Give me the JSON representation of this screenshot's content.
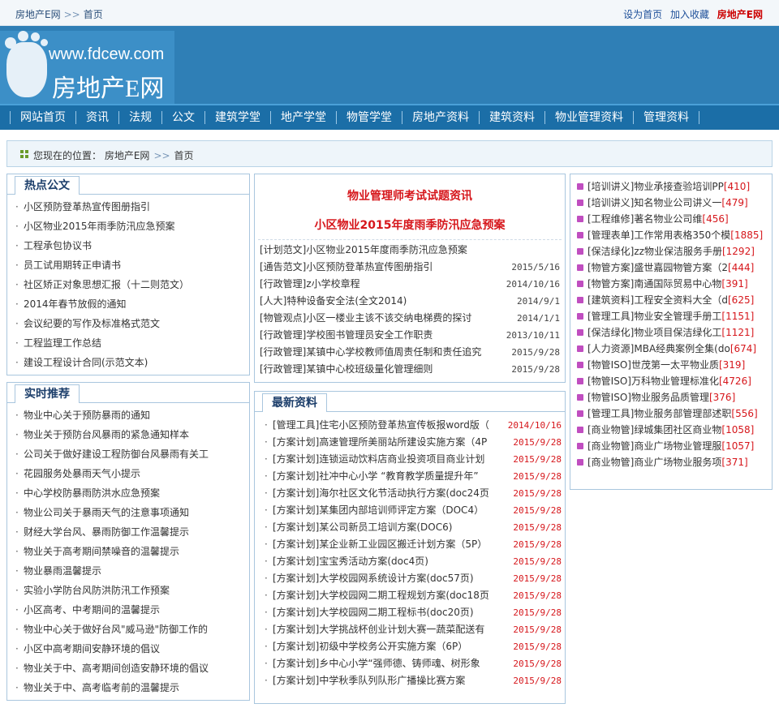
{
  "topbar": {
    "crumb_home": "房地产E网",
    "crumb_sep": ">>",
    "crumb_current": "首页",
    "set_home": "设为首页",
    "add_fav": "加入收藏",
    "brand": "房地产E网"
  },
  "logo": {
    "url": "www.fdcew.com",
    "cn": "房地产E网"
  },
  "nav": [
    "网站首页",
    "资讯",
    "法规",
    "公文",
    "建筑学堂",
    "地产学堂",
    "物管学堂",
    "房地产资料",
    "建筑资料",
    "物业管理资料",
    "管理资料"
  ],
  "location": {
    "label": "您现在的位置：",
    "home": "房地产E网",
    "sep": ">>",
    "current": "首页"
  },
  "hot": {
    "title": "热点公文",
    "items": [
      "小区预防登革热宣传图册指引",
      "小区物业2015年雨季防汛应急预案",
      "工程承包协议书",
      "员工试用期转正申请书",
      "社区矫正对象思想汇报（十二则范文）",
      "2014年春节放假的通知",
      "会议纪要的写作及标准格式范文",
      "工程监理工作总结",
      "建设工程设计合同(示范文本)"
    ]
  },
  "recommend": {
    "title": "实时推荐",
    "items": [
      "物业中心关于预防暴雨的通知",
      "物业关于预防台风暴雨的紧急通知样本",
      "公司关于做好建设工程防御台风暴雨有关工",
      "花园服务处暴雨天气小提示",
      "中心学校防暴雨防洪水应急预案",
      "物业公司关于暴雨天气的注意事项通知",
      "财经大学台风、暴雨防御工作温馨提示",
      "物业关于高考期间禁噪音的温馨提示",
      "物业暴雨温馨提示",
      "实验小学防台风防洪防汛工作预案",
      "小区高考、中考期间的温馨提示",
      "物业中心关于做好台风\"威马逊\"防御工作的",
      "小区中高考期间安静环境的倡议",
      "物业关于中、高考期间创造安静环境的倡议",
      "物业关于中、高考临考前的温馨提示"
    ]
  },
  "feature": {
    "head1": "物业管理师考试试题资讯",
    "head2": "小区物业2015年度雨季防汛应急预案",
    "rows": [
      {
        "cat": "[计划范文]",
        "title": "小区物业2015年度雨季防汛应急预案",
        "date": ""
      },
      {
        "cat": "[通告范文]",
        "title": "小区预防登革热宣传图册指引",
        "date": "2015/5/16"
      },
      {
        "cat": "[行政管理]",
        "title": "z小学校章程",
        "date": "2014/10/16"
      },
      {
        "cat": "[人大]",
        "title": "特种设备安全法(全文2014)",
        "date": "2014/9/1"
      },
      {
        "cat": "[物管观点]",
        "title": "小区一楼业主该不该交纳电梯费的探讨",
        "date": "2014/1/1"
      },
      {
        "cat": "[行政管理]",
        "title": "学校图书管理员安全工作职责",
        "date": "2013/10/11"
      },
      {
        "cat": "[行政管理]",
        "title": "某镇中心学校教师值周责任制和责任追究",
        "date": "2015/9/28"
      },
      {
        "cat": "[行政管理]",
        "title": "某镇中心校班级量化管理细则",
        "date": "2015/9/28"
      }
    ]
  },
  "latest": {
    "title": "最新资料",
    "rows": [
      {
        "cat": "[管理工具]",
        "title": "住宅小区预防登革热宣传板报word版（",
        "date": "2014/10/16"
      },
      {
        "cat": "[方案计划]",
        "title": "高速管理所美丽站所建设实施方案（4P",
        "date": "2015/9/28"
      },
      {
        "cat": "[方案计划]",
        "title": "连锁运动饮料店商业投资项目商业计划",
        "date": "2015/9/28"
      },
      {
        "cat": "[方案计划]",
        "title": "社冲中心小学 “教育教学质量提升年”",
        "date": "2015/9/28"
      },
      {
        "cat": "[方案计划]",
        "title": "海尔社区文化节活动执行方案(doc24页",
        "date": "2015/9/28"
      },
      {
        "cat": "[方案计划]",
        "title": "某集团内部培训师评定方案（DOC4）",
        "date": "2015/9/28"
      },
      {
        "cat": "[方案计划]",
        "title": "某公司新员工培训方案(DOC6)",
        "date": "2015/9/28"
      },
      {
        "cat": "[方案计划]",
        "title": "某企业新工业园区搬迁计划方案（5P）",
        "date": "2015/9/28"
      },
      {
        "cat": "[方案计划]",
        "title": "宝宝秀活动方案(doc4页)",
        "date": "2015/9/28"
      },
      {
        "cat": "[方案计划]",
        "title": "大学校园网系统设计方案(doc57页)",
        "date": "2015/9/28"
      },
      {
        "cat": "[方案计划]",
        "title": "大学校园网二期工程规划方案(doc18页",
        "date": "2015/9/28"
      },
      {
        "cat": "[方案计划]",
        "title": "大学校园网二期工程标书(doc20页)",
        "date": "2015/9/28"
      },
      {
        "cat": "[方案计划]",
        "title": "大学挑战杯创业计划大赛一蔬菜配送有",
        "date": "2015/9/28"
      },
      {
        "cat": "[方案计划]",
        "title": "初级中学校务公开实施方案（6P）",
        "date": "2015/9/28"
      },
      {
        "cat": "[方案计划]",
        "title": "乡中心小学“强师德、铸师魂、树形象",
        "date": "2015/9/28"
      },
      {
        "cat": "[方案计划]",
        "title": "中学秋季队列队形广播操比赛方案",
        "date": "2015/9/28"
      }
    ]
  },
  "side": {
    "rows": [
      {
        "cat": "[培训讲义]",
        "title": "物业承接查验培训PP",
        "num": "[410]"
      },
      {
        "cat": "[培训讲义]",
        "title": "知名物业公司讲义一",
        "num": "[479]"
      },
      {
        "cat": "[工程维修]",
        "title": "著名物业公司维",
        "num": "[456]"
      },
      {
        "cat": "[管理表单]",
        "title": "工作常用表格350个模",
        "num": "[1885]"
      },
      {
        "cat": "[保洁绿化]",
        "title": "zz物业保洁服务手册",
        "num": "[1292]"
      },
      {
        "cat": "[物管方案]",
        "title": "盛世嘉园物管方案（2",
        "num": "[444]"
      },
      {
        "cat": "[物管方案]",
        "title": "南通国际贸易中心物",
        "num": "[391]"
      },
      {
        "cat": "[建筑资料]",
        "title": "工程安全资料大全（d",
        "num": "[625]"
      },
      {
        "cat": "[管理工具]",
        "title": "物业安全管理手册工",
        "num": "[1151]"
      },
      {
        "cat": "[保洁绿化]",
        "title": "物业项目保洁绿化工",
        "num": "[1121]"
      },
      {
        "cat": "[人力资源]",
        "title": "MBA经典案例全集(do",
        "num": "[674]"
      },
      {
        "cat": "[物管ISO]",
        "title": "世茂第一太平物业质",
        "num": "[319]"
      },
      {
        "cat": "[物管ISO]",
        "title": "万科物业管理标准化",
        "num": "[4726]"
      },
      {
        "cat": "[物管ISO]",
        "title": "物业服务品质管理",
        "num": "[376]"
      },
      {
        "cat": "[管理工具]",
        "title": "物业服务部管理部述职",
        "num": "[556]"
      },
      {
        "cat": "[商业物管]",
        "title": "绿城集团社区商业物",
        "num": "[1058]"
      },
      {
        "cat": "[商业物管]",
        "title": "商业广场物业管理服",
        "num": "[1057]"
      },
      {
        "cat": "[商业物管]",
        "title": "商业广场物业服务项",
        "num": "[371]"
      }
    ]
  }
}
